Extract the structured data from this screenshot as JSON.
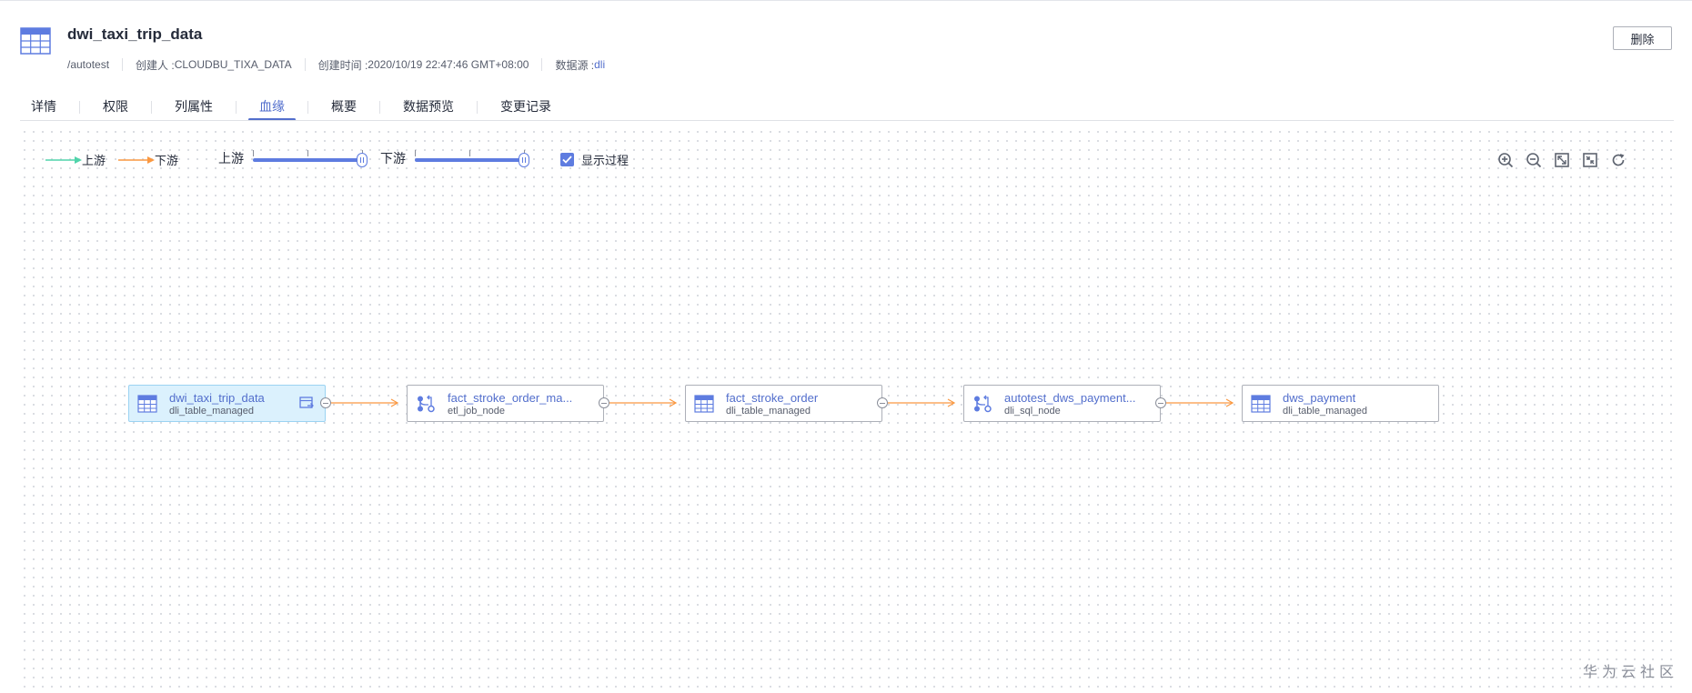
{
  "header": {
    "title": "dwi_taxi_trip_data",
    "path": "/autotest",
    "creator_label": "创建人 : ",
    "creator": "CLOUDBU_TIXA_DATA",
    "created_label": "创建时间 : ",
    "created_time": "2020/10/19 22:47:46 GMT+08:00",
    "datasource_label": "数据源 : ",
    "datasource": "dli",
    "delete_label": "删除"
  },
  "tabs": [
    {
      "label": "详情",
      "active": false
    },
    {
      "label": "权限",
      "active": false
    },
    {
      "label": "列属性",
      "active": false
    },
    {
      "label": "血缘",
      "active": true
    },
    {
      "label": "概要",
      "active": false
    },
    {
      "label": "数据预览",
      "active": false
    },
    {
      "label": "变更记录",
      "active": false
    }
  ],
  "legend": {
    "upstream_label": "上游",
    "downstream_label": "下游",
    "upstream_color": "#50d4ab",
    "downstream_color": "#fa9841"
  },
  "controls": {
    "upstream_slider_label": "上游",
    "downstream_slider_label": "下游",
    "upstream_level": 3,
    "downstream_level": 3,
    "max_level": 3,
    "show_process_label": "显示过程",
    "show_process_checked": true
  },
  "toolbar": {
    "tools": [
      "zoom-in-icon",
      "zoom-out-icon",
      "fit-view-icon",
      "actual-size-icon",
      "refresh-icon"
    ]
  },
  "nodes": [
    {
      "name": "dwi_taxi_trip_data",
      "type": "dli_table_managed",
      "icon": "table-icon",
      "selected": true
    },
    {
      "name": "fact_stroke_order_ma...",
      "type": "etl_job_node",
      "icon": "process-icon",
      "selected": false
    },
    {
      "name": "fact_stroke_order",
      "type": "dli_table_managed",
      "icon": "table-icon",
      "selected": false
    },
    {
      "name": "autotest_dws_payment...",
      "type": "dli_sql_node",
      "icon": "process-icon",
      "selected": false
    },
    {
      "name": "dws_payment",
      "type": "dli_table_managed",
      "icon": "table-icon",
      "selected": false
    }
  ],
  "colors": {
    "accent": "#526ecc",
    "slider": "#5e7ce0",
    "selected_node_bg": "#dbf1fd"
  },
  "watermark": "华为云社区"
}
